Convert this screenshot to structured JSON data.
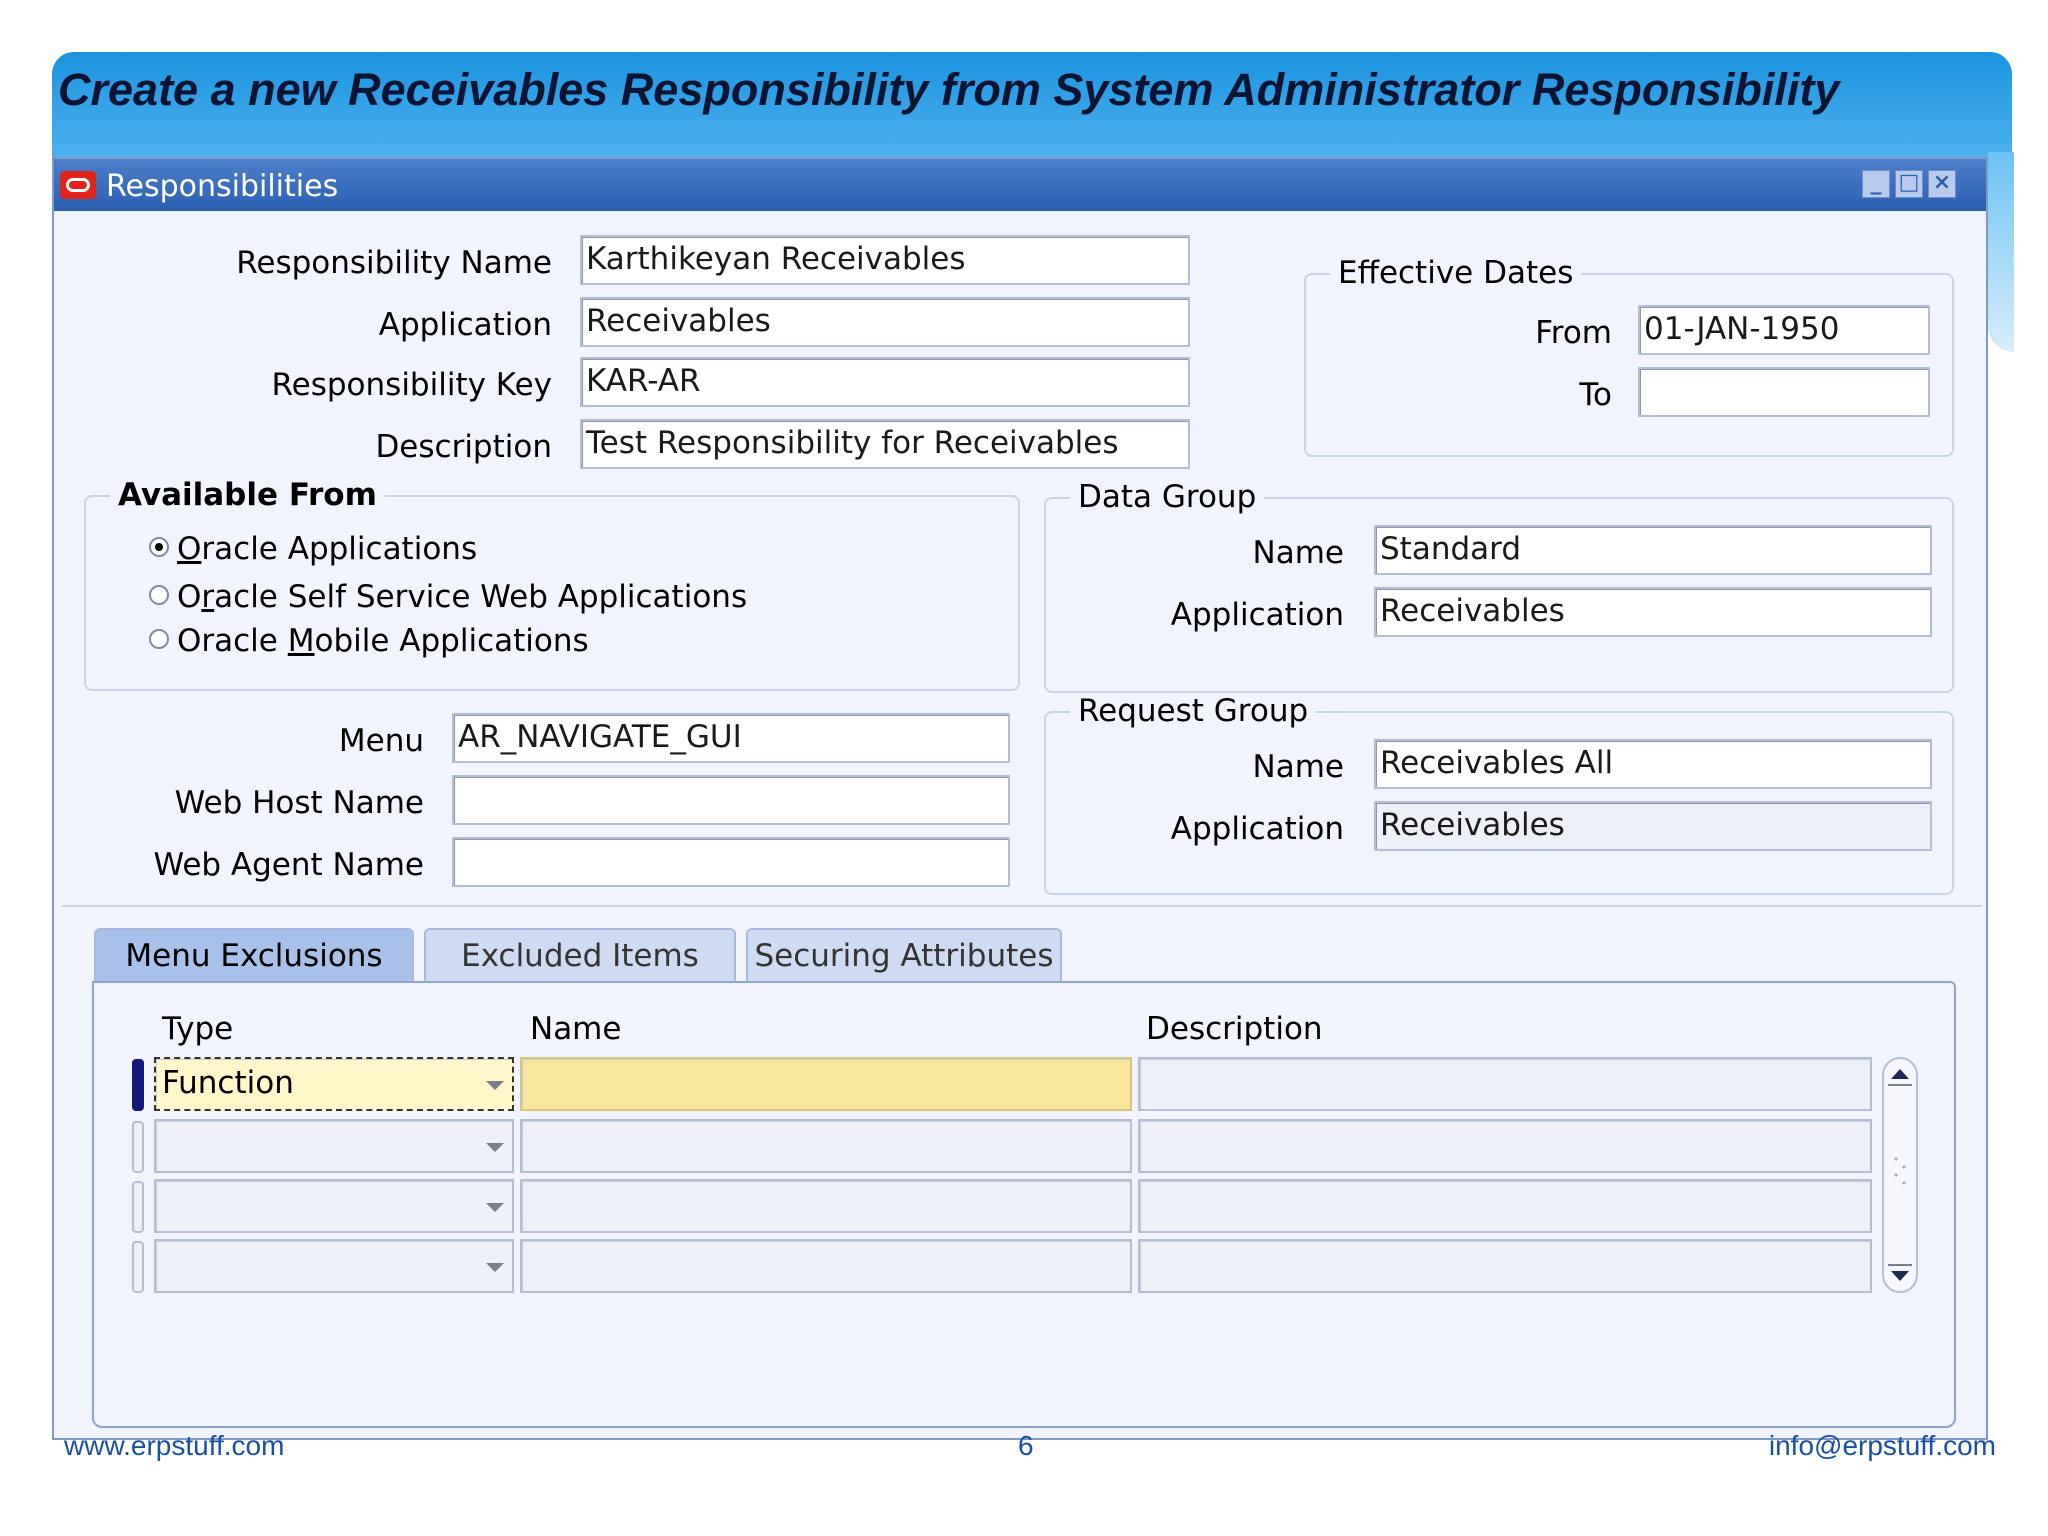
{
  "slide": {
    "title": "Create a new Receivables Responsibility from System Administrator Responsibility",
    "footer_left": "www.erpstuff.com",
    "footer_center": "6",
    "footer_right": "info@erpstuff.com"
  },
  "window": {
    "title": "Responsibilities",
    "minimize": "_",
    "maximize": "□",
    "close": "×"
  },
  "form": {
    "resp_name_label": "Responsibility Name",
    "resp_name_value": "Karthikeyan Receivables",
    "application_label": "Application",
    "application_value": "Receivables",
    "resp_key_label": "Responsibility Key",
    "resp_key_value": "KAR-AR",
    "description_label": "Description",
    "description_value": "Test Responsibility for Receivables"
  },
  "effective_dates": {
    "legend": "Effective Dates",
    "from_label": "From",
    "from_value": "01-JAN-1950",
    "to_label": "To",
    "to_value": ""
  },
  "available_from": {
    "legend": "Available From",
    "options": [
      {
        "prefix": "",
        "underline": "O",
        "rest": "racle Applications",
        "selected": true
      },
      {
        "prefix": "O",
        "underline": "r",
        "rest": "acle Self Service Web Applications",
        "selected": false
      },
      {
        "prefix": "Oracle ",
        "underline": "M",
        "rest": "obile Applications",
        "selected": false
      }
    ]
  },
  "data_group": {
    "legend": "Data Group",
    "name_label": "Name",
    "name_value": "Standard",
    "application_label": "Application",
    "application_value": "Receivables"
  },
  "menu_section": {
    "menu_label": "Menu",
    "menu_value": "AR_NAVIGATE_GUI",
    "web_host_label": "Web Host Name",
    "web_host_value": "",
    "web_agent_label": "Web Agent Name",
    "web_agent_value": ""
  },
  "request_group": {
    "legend": "Request Group",
    "name_label": "Name",
    "name_value": "Receivables All",
    "application_label": "Application",
    "application_value": "Receivables"
  },
  "tabs": [
    {
      "label": "Menu Exclusions",
      "active": true
    },
    {
      "label": "Excluded Items",
      "active": false
    },
    {
      "label": "Securing Attributes",
      "active": false
    }
  ],
  "exclusions_table": {
    "columns": [
      "Type",
      "Name",
      "Description"
    ],
    "rows": [
      {
        "type": "Function",
        "name": "",
        "description": ""
      },
      {
        "type": "",
        "name": "",
        "description": ""
      },
      {
        "type": "",
        "name": "",
        "description": ""
      },
      {
        "type": "",
        "name": "",
        "description": ""
      }
    ]
  },
  "colors": {
    "banner": "#1a93e0",
    "titlebar": "#2a5fb2",
    "form_bg": "#f2f4fd",
    "active_cell": "#fbe6a0",
    "current_row": "#15187a"
  }
}
